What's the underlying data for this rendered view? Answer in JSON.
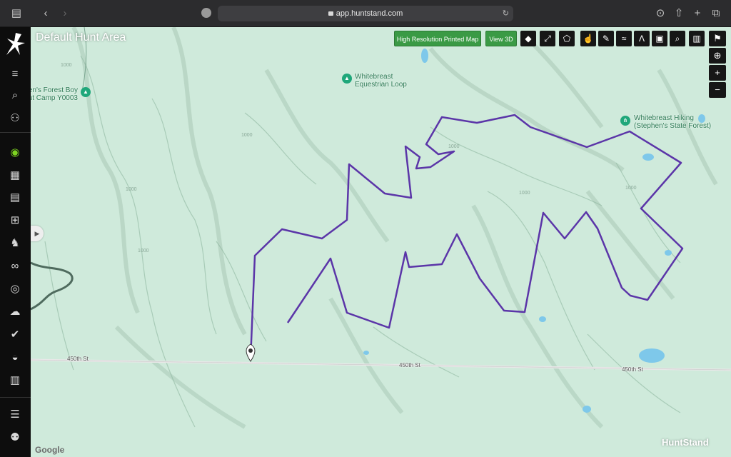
{
  "browser": {
    "url": "app.huntstand.com",
    "icons": [
      "sidebar-toggle-icon",
      "back-icon",
      "forward-icon",
      "reload-icon",
      "download-icon",
      "share-icon",
      "new-tab-icon",
      "tabs-icon"
    ]
  },
  "sidebar": {
    "items": [
      {
        "name": "menu",
        "icon": "≡"
      },
      {
        "name": "search",
        "icon": "⌕"
      },
      {
        "name": "groups",
        "icon": "⚇"
      },
      {
        "name": "map-layers",
        "icon": "◉",
        "active": true
      },
      {
        "name": "calendar-check",
        "icon": "▦"
      },
      {
        "name": "stand",
        "icon": "▤"
      },
      {
        "name": "tree-stand",
        "icon": "⊞"
      },
      {
        "name": "deer",
        "icon": "♞"
      },
      {
        "name": "binoculars",
        "icon": "∞"
      },
      {
        "name": "target",
        "icon": "◎"
      },
      {
        "name": "weather",
        "icon": "☁"
      },
      {
        "name": "check",
        "icon": "✔"
      },
      {
        "name": "solunar",
        "icon": "◒"
      },
      {
        "name": "planner",
        "icon": "▥"
      },
      {
        "name": "settings",
        "icon": "☰"
      },
      {
        "name": "add-user",
        "icon": "⚉"
      }
    ]
  },
  "map": {
    "title": "Default Hunt Area",
    "print_button": "High Resolution Printed Map",
    "view3d_button": "View 3D",
    "tools": [
      "◆",
      "⤢",
      "⬠",
      "☝",
      "✎",
      "≈",
      "Λ",
      "▣",
      "⌕",
      "▥"
    ],
    "right_tools": [
      "⚑",
      "⊕",
      "+",
      "−"
    ],
    "pois": [
      {
        "label": "Whitebreast\nEquestrian Loop"
      },
      {
        "label": "en's Forest Boy\nut Camp Y0003"
      },
      {
        "label": "Whitebreast Hiking\n(Stephen's State Forest)"
      }
    ],
    "roads": [
      "450th St",
      "450th St",
      "450th St"
    ],
    "contours": [
      "1000",
      "1000",
      "1000",
      "1000",
      "1000",
      "1000",
      "1000"
    ],
    "attribution": "Google",
    "brand": "HuntStand",
    "colors": {
      "boundary": "#5b35a8",
      "poi": "#1fa77a",
      "terrain": "#cde9d9",
      "button_green": "#3a9a45"
    }
  }
}
